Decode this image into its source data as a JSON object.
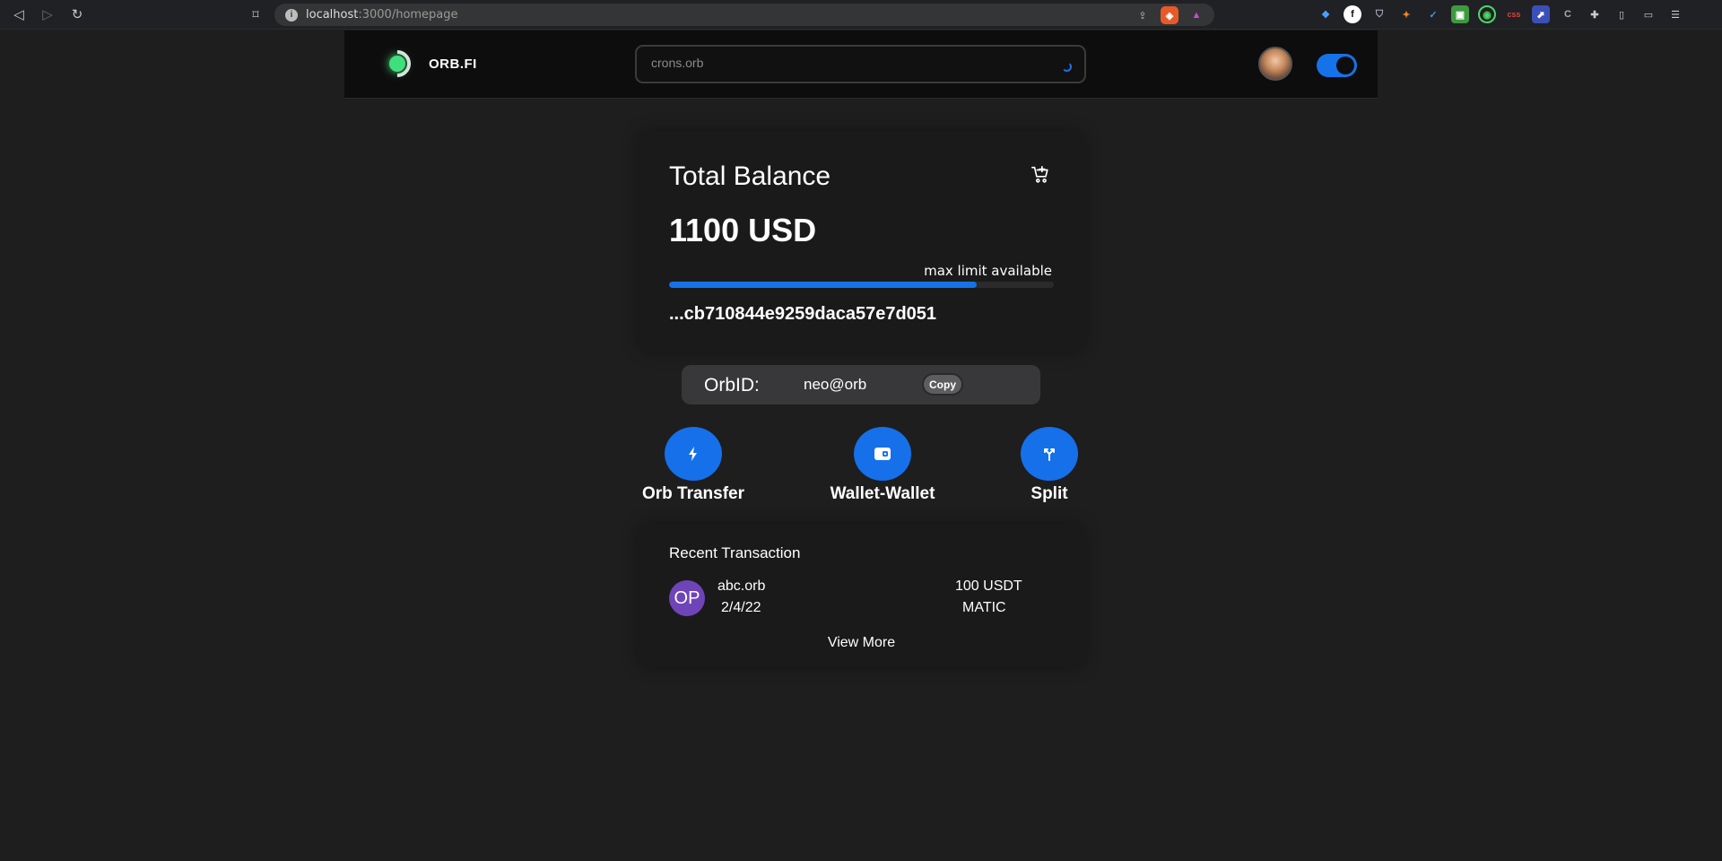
{
  "browser": {
    "url_host": "localhost",
    "url_path": ":3000/homepage"
  },
  "header": {
    "brand": "ORB.FI",
    "search_placeholder": "crons.orb"
  },
  "balance": {
    "title": "Total Balance",
    "value": "1100 USD",
    "limit_label": "max limit available",
    "limit_fraction": 0.8,
    "address": "...cb710844e9259daca57e7d051"
  },
  "orbid": {
    "label": "OrbID:",
    "value": "neo@orb",
    "copy_label": "Copy"
  },
  "actions": [
    {
      "label": "Orb Transfer",
      "icon": "lightning-icon"
    },
    {
      "label": "Wallet-Wallet",
      "icon": "wallet-icon"
    },
    {
      "label": "Split",
      "icon": "split-icon"
    }
  ],
  "transactions": {
    "title": "Recent Transaction",
    "items": [
      {
        "initials": "OP",
        "name": "abc.orb",
        "date": "2/4/22",
        "amount": "100 USDT",
        "chain": "MATIC"
      }
    ],
    "view_more": "View More"
  },
  "colors": {
    "accent": "#1572e8",
    "background": "#1e1e1f",
    "card": "#1a1a1b",
    "logo_green": "#3fe07b",
    "avatar_purple": "#6f44b8"
  }
}
